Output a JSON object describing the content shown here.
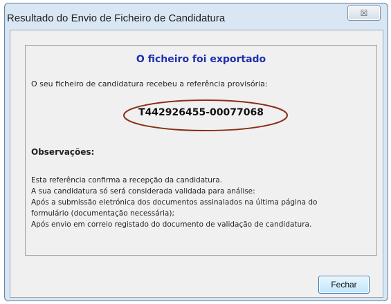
{
  "window": {
    "title": "Resultado do Envio de Ficheiro de Candidatura",
    "close_glyph": "☒"
  },
  "panel": {
    "heading": "O ficheiro foi exportado",
    "intro": "O seu ficheiro de candidatura recebeu a referência provisória:",
    "reference": "T442926455-00077068",
    "observations_heading": "Observações:",
    "observations": [
      "Esta referência confirma a recepção da candidatura.",
      "A sua candidatura só será considerada validada para análise:",
      "Após a submissão eletrónica dos documentos assinalados na última página do",
      "formulário (documentação necessária);",
      "Após envio em correio registado do documento de validação de candidatura."
    ]
  },
  "buttons": {
    "close_label": "Fechar"
  },
  "colors": {
    "heading": "#1f2fae",
    "highlight": "#8b2e17"
  }
}
